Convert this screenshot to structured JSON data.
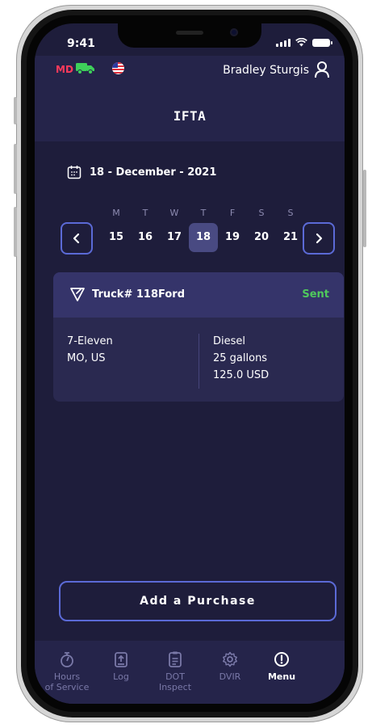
{
  "status_bar": {
    "time": "9:41"
  },
  "header": {
    "state_code": "MD",
    "user_name": "Bradley Sturgis",
    "title": "IFTA"
  },
  "calendar": {
    "date_label": "18 - December - 2021",
    "weekdays": [
      "M",
      "T",
      "W",
      "T",
      "F",
      "S",
      "S"
    ],
    "days": [
      "15",
      "16",
      "17",
      "18",
      "19",
      "20",
      "21"
    ],
    "selected_day": "18"
  },
  "purchase_card": {
    "truck": "Truck# 118Ford",
    "status": "Sent",
    "station": "7-Eleven",
    "location": "MO, US",
    "fuel_type": "Diesel",
    "quantity": "25 gallons",
    "amount": "125.0 USD"
  },
  "add_purchase_label": "Add a Purchase",
  "bottom_nav": {
    "items": [
      {
        "line1": "Hours",
        "line2": "of Service",
        "icon": "stopwatch-icon"
      },
      {
        "line1": "Log",
        "line2": "",
        "icon": "log-upload-icon"
      },
      {
        "line1": "DOT",
        "line2": "Inspect",
        "icon": "clipboard-icon"
      },
      {
        "line1": "DVIR",
        "line2": "",
        "icon": "gear-icon"
      },
      {
        "line1": "Menu",
        "line2": "",
        "icon": "info-icon"
      }
    ],
    "active": "Menu"
  },
  "colors": {
    "background": "#1e1d3b",
    "header": "#25244a",
    "accent_border": "#5b6ad6",
    "sent_green": "#4fc95c",
    "state_red": "#ff3a5b"
  }
}
